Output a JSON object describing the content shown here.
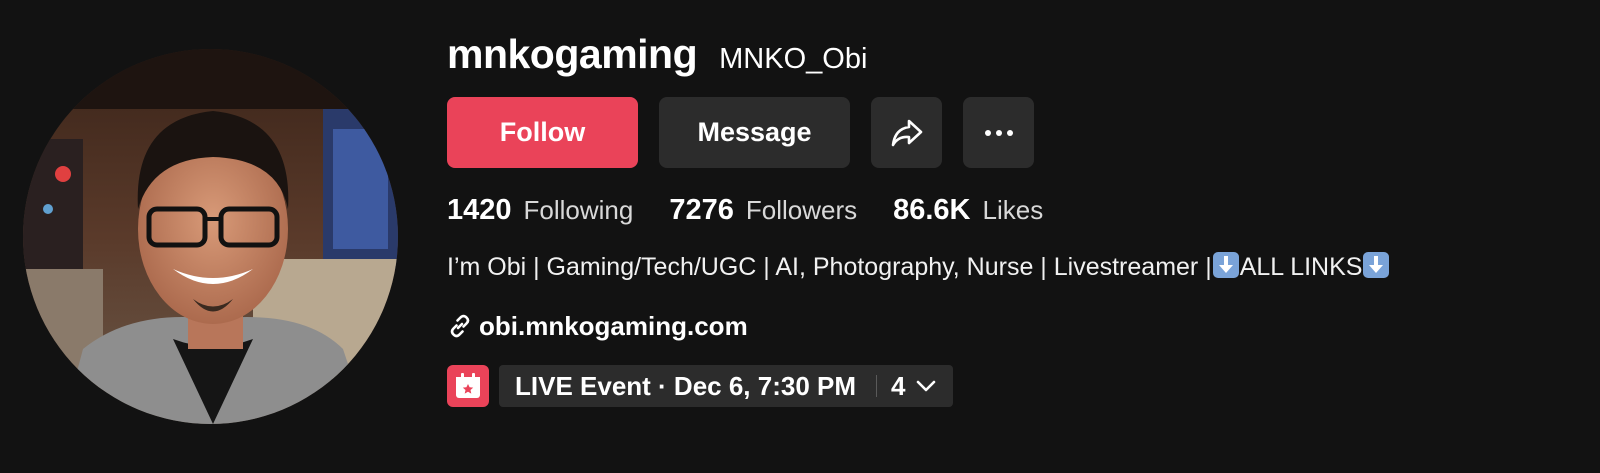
{
  "profile": {
    "username": "mnkogaming",
    "nickname": "MNKO_Obi",
    "avatar_alt": "profile-photo"
  },
  "actions": {
    "follow_label": "Follow",
    "message_label": "Message",
    "share_icon": "share-icon",
    "more_icon": "more-icon"
  },
  "stats": [
    {
      "value": "1420",
      "label": "Following"
    },
    {
      "value": "7276",
      "label": "Followers"
    },
    {
      "value": "86.6K",
      "label": "Likes"
    }
  ],
  "bio": {
    "part1": "I’m Obi | Gaming/Tech/UGC | AI, Photography, Nurse | Livestreamer |",
    "part2": "ALL LINKS"
  },
  "link": {
    "icon": "link-icon",
    "text": "obi.mnkogaming.com"
  },
  "event": {
    "icon": "calendar-star-icon",
    "text": "LIVE Event · Dec 6, 7:30 PM",
    "count": "4"
  },
  "colors": {
    "background": "#121212",
    "accent": "#ea4359",
    "button_secondary": "#2c2c2c"
  }
}
